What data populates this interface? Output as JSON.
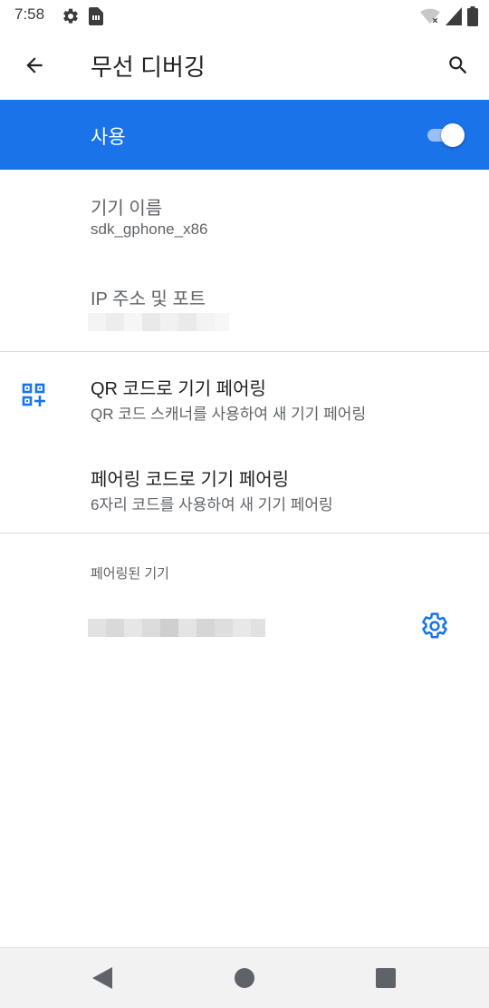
{
  "status_bar": {
    "time": "7:58",
    "icons": [
      "gear-icon",
      "sim-card-icon",
      "wifi-no-internet-icon",
      "cell-signal-icon",
      "battery-icon"
    ]
  },
  "app_bar": {
    "title": "무선 디버깅",
    "icons": [
      "back-arrow-icon",
      "search-icon"
    ]
  },
  "master_switch": {
    "label": "사용",
    "enabled": true,
    "accent_color": "#1a73e8"
  },
  "device_name": {
    "title": "기기 이름",
    "value": "sdk_gphone_x86"
  },
  "ip_port": {
    "title": "IP 주소 및 포트"
  },
  "qr_pairing": {
    "title": "QR 코드로 기기 페어링",
    "summary": "QR 코드 스캐너를 사용하여 새 기기 페어링",
    "icon": "qr-code-icon"
  },
  "code_pairing": {
    "title": "페어링 코드로 기기 페어링",
    "summary": "6자리 코드를 사용하여 새 기기 페어링"
  },
  "paired_devices": {
    "category_title": "페어링된 기기",
    "settings_icon": "settings-gear-icon"
  },
  "nav_bar": {
    "icons": [
      "nav-back-icon",
      "nav-home-icon",
      "nav-recents-icon"
    ]
  }
}
